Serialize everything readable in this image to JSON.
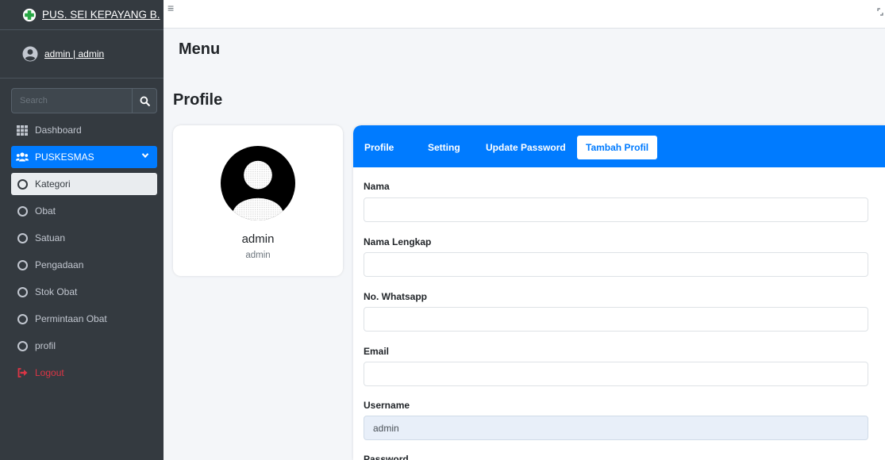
{
  "sidebar": {
    "brand": "PUS. SEI KEPAYANG B.",
    "user": "admin | admin",
    "search_placeholder": "Search",
    "items": [
      {
        "label": "Dashboard"
      },
      {
        "label": "PUSKESMAS"
      },
      {
        "label": "Kategori"
      },
      {
        "label": "Obat"
      },
      {
        "label": "Satuan"
      },
      {
        "label": "Pengadaan"
      },
      {
        "label": "Stok Obat"
      },
      {
        "label": "Permintaan Obat"
      },
      {
        "label": "profil"
      },
      {
        "label": "Logout"
      }
    ]
  },
  "topbar": {
    "hamburger": "≡"
  },
  "main": {
    "menu_title": "Menu",
    "profile_title": "Profile",
    "profile_card": {
      "name": "admin",
      "username": "admin"
    },
    "tabs": [
      {
        "label": "Profile"
      },
      {
        "label": "Setting"
      },
      {
        "label": "Update Password"
      },
      {
        "label": "Tambah Profil"
      }
    ],
    "form": {
      "nama_label": "Nama",
      "nama_value": "",
      "nama_lengkap_label": "Nama Lengkap",
      "nama_lengkap_value": "",
      "whatsapp_label": "No. Whatsapp",
      "whatsapp_value": "",
      "email_label": "Email",
      "email_value": "",
      "username_label": "Username",
      "username_value": "admin",
      "password_label": "Password"
    }
  },
  "colors": {
    "sidebar_bg": "#343a40",
    "accent": "#007bff",
    "logout": "#dc3545"
  }
}
